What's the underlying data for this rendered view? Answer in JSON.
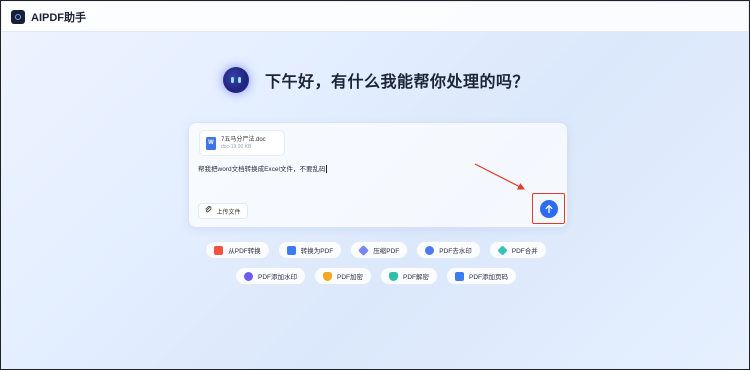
{
  "app": {
    "title": "AIPDF助手"
  },
  "greeting": "下午好，有什么我能帮你处理的吗？",
  "attachment": {
    "name": "7五马分尸法.doc",
    "size": "doc-19.00 KB",
    "badge": "W"
  },
  "prompt": {
    "value": "帮我把word文档转换成Excel文件，不要乱码"
  },
  "upload_button": {
    "label": "上传文件"
  },
  "quick_actions_row1": [
    {
      "label": "从PDF转换",
      "icon": "pdf-convert-icon",
      "color": "#f0523f"
    },
    {
      "label": "转换为PDF",
      "icon": "to-pdf-icon",
      "color": "#3d7cf0"
    },
    {
      "label": "压缩PDF",
      "icon": "compress-icon",
      "color": "#7a86f5"
    },
    {
      "label": "PDF去水印",
      "icon": "remove-watermark-icon",
      "color": "#4d7af3"
    },
    {
      "label": "PDF合并",
      "icon": "merge-icon",
      "color": "#36c2b4"
    }
  ],
  "quick_actions_row2": [
    {
      "label": "PDF添加水印",
      "icon": "add-watermark-icon",
      "color": "#6a5cf0"
    },
    {
      "label": "PDF加密",
      "icon": "encrypt-icon",
      "color": "#f5a623"
    },
    {
      "label": "PDF解密",
      "icon": "decrypt-icon",
      "color": "#2fbfa8"
    },
    {
      "label": "PDF添加页码",
      "icon": "page-number-icon",
      "color": "#3d7cf0"
    }
  ],
  "colors": {
    "accent": "#2d6cf0",
    "annotation": "#e23a2c"
  }
}
